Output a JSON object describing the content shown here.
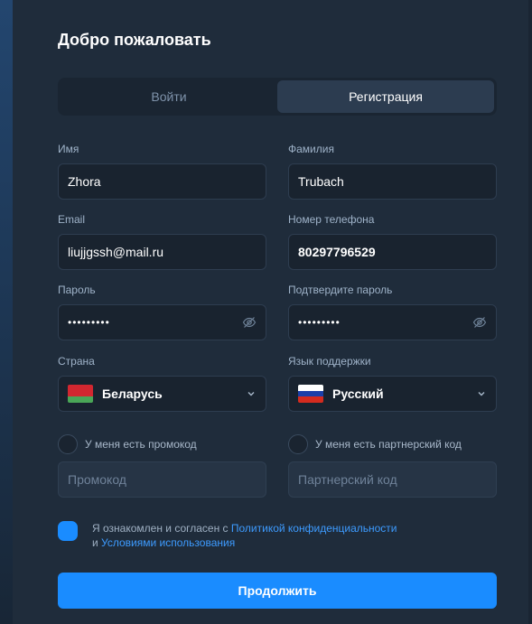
{
  "title": "Добро пожаловать",
  "tabs": [
    {
      "label": "Войти",
      "active": false
    },
    {
      "label": "Регистрация",
      "active": true
    }
  ],
  "fields": {
    "first_name": {
      "label": "Имя",
      "value": "Zhora"
    },
    "last_name": {
      "label": "Фамилия",
      "value": "Trubach"
    },
    "email": {
      "label": "Email",
      "value": "liujjgssh@mail.ru"
    },
    "phone": {
      "label": "Номер телефона",
      "value": "80297796529"
    },
    "password": {
      "label": "Пароль",
      "value": "•••••••••"
    },
    "password_confirm": {
      "label": "Подтвердите пароль",
      "value": "•••••••••"
    },
    "country": {
      "label": "Страна",
      "value": "Беларусь"
    },
    "support_language": {
      "label": "Язык поддержки",
      "value": "Русский"
    }
  },
  "promo": {
    "checkbox_label": "У меня есть промокод",
    "placeholder": "Промокод",
    "checked": false
  },
  "partner": {
    "checkbox_label": "У меня есть партнерский код",
    "placeholder": "Партнерский код",
    "checked": false
  },
  "consent": {
    "text_1": "Я ознакомлен и согласен с ",
    "link_privacy": "Политикой конфиденциальности",
    "text_2": "и ",
    "link_terms": "Условиями использования",
    "checked": true
  },
  "submit_label": "Продолжить",
  "colors": {
    "accent": "#1a8cff",
    "background": "#1f2c3b",
    "link": "#3d9bff"
  },
  "icons": [
    "eye-off-icon",
    "chevron-down-icon",
    "flag-belarus-icon",
    "flag-russia-icon"
  ]
}
